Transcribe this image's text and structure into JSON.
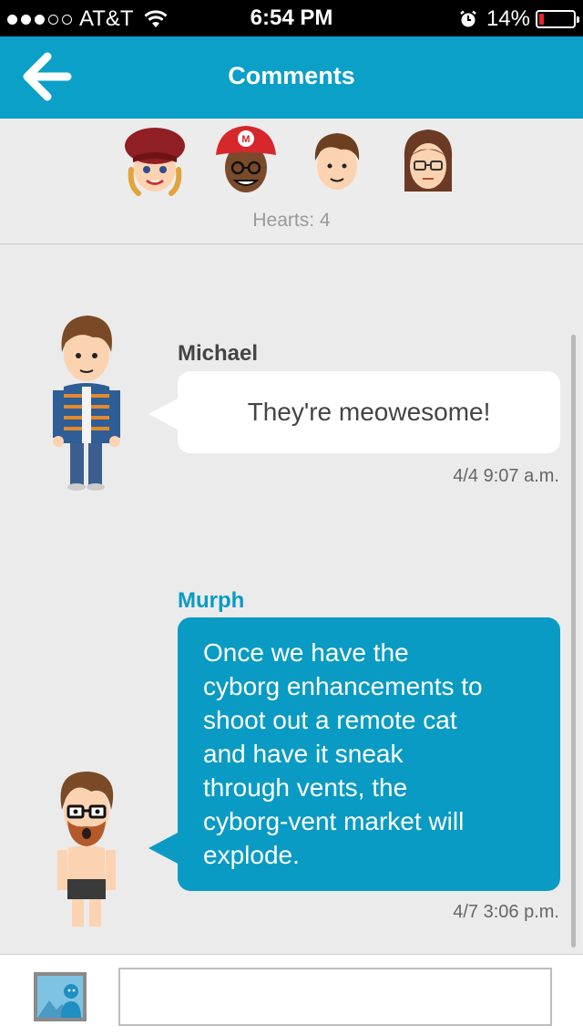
{
  "status_bar": {
    "carrier": "AT&T",
    "signal_bars_filled": 3,
    "signal_bars_total": 5,
    "time": "6:54 PM",
    "battery_percent": "14%",
    "battery_level": 0.14,
    "icons": [
      "wifi-icon",
      "alarm-icon",
      "battery-icon"
    ]
  },
  "header": {
    "title": "Comments",
    "back_icon": "arrow-left-icon"
  },
  "hearts": {
    "label": "Hearts: 4",
    "avatars": [
      "mii-avatar-red-beret",
      "mii-avatar-mario-hat",
      "mii-avatar-brown-hair",
      "mii-avatar-glasses-woman"
    ]
  },
  "comments": [
    {
      "author": "Michael",
      "text": "They're meowesome!",
      "timestamp": "4/4 9:07 a.m."
    },
    {
      "author": "Murph",
      "text": "Once we have the\ncyborg enhancements to\nshoot out a remote cat\nand have it sneak\nthrough vents, the\ncyborg-vent market will\nexplode.",
      "timestamp": "4/7 3:06 p.m."
    }
  ],
  "input_bar": {
    "image_icon": "image-attach-icon",
    "placeholder": ""
  },
  "colors": {
    "accent": "#0aa0c8",
    "own_bubble": "#0a9bc4",
    "other_bubble": "#ffffff",
    "background": "#ebebeb",
    "battery_low": "#e3262b"
  }
}
